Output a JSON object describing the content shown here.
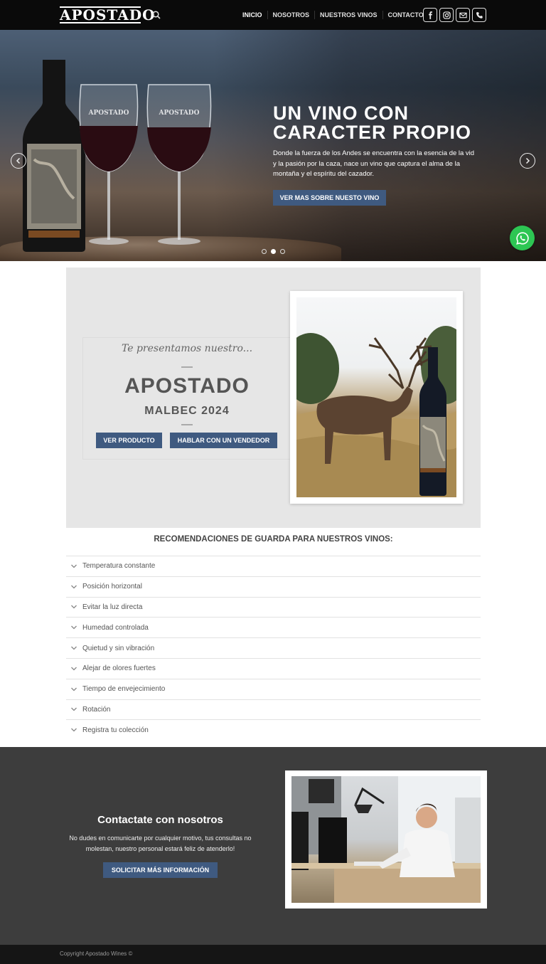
{
  "header": {
    "logo": "APOSTADO",
    "nav": [
      "INICIO",
      "NOSOTROS",
      "NUESTROS VINOS",
      "CONTACTO"
    ],
    "socials": [
      "facebook-icon",
      "instagram-icon",
      "mail-icon",
      "phone-icon"
    ]
  },
  "hero": {
    "title_line1": "UN VINO CON",
    "title_line2": "CARACTER PROPIO",
    "text": "Donde la fuerza de los Andes se encuentra con la esencia de la vid y la pasión por la caza, nace un vino que captura el alma de la montaña y el espíritu del cazador.",
    "button": "VER MAS SOBRE NUESTO VINO",
    "slides": 3,
    "active_slide": 2
  },
  "featured": {
    "intro": "Te presentamos nuestro...",
    "title": "APOSTADO",
    "subtitle": "MALBEC 2024",
    "btn_product": "VER PRODUCTO",
    "btn_seller": "HABLAR CON UN VENDEDOR"
  },
  "recommendations": {
    "title": "RECOMENDACIONES DE GUARDA PARA NUESTROS VINOS:",
    "items": [
      "Temperatura constante",
      "Posición horizontal",
      "Evitar la luz directa",
      "Humedad controlada",
      "Quietud y sin vibración",
      "Alejar de olores fuertes",
      "Tiempo de envejecimiento",
      "Rotación",
      "Registra tu colección"
    ]
  },
  "contact": {
    "title": "Contactate con nosotros",
    "text": "No dudes en comunicarte por cualquier motivo, tus consultas no molestan, nuestro personal estará feliz de atenderlo!",
    "button": "SOLICITAR MÁS INFORMACIÓN"
  },
  "footer": {
    "copyright": "Copyright Apostado Wines ©"
  },
  "colors": {
    "accent": "#3f5a80",
    "header": "#0a0a0a",
    "contact_bg": "#3d3d3d",
    "whatsapp": "#2dc653"
  }
}
